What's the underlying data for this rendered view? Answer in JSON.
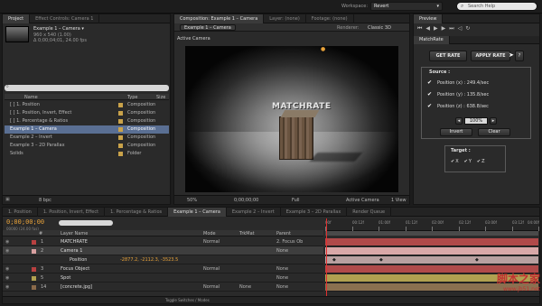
{
  "workspace": {
    "label": "Workspace:",
    "value": "Revert",
    "search_placeholder": "Search Help"
  },
  "project_panel": {
    "tabs": [
      "Project",
      "Effect Controls: Camera 1"
    ],
    "comp_name": "Example 1 – Camera ▾",
    "comp_size": "960 x 540 (1.00)",
    "comp_duration": "Δ 0;00;04;01, 24.00 fps",
    "search_placeholder": "",
    "headers": {
      "name": "Name",
      "type": "Type",
      "size": "Size"
    },
    "items": [
      {
        "name": "[ ] 1. Position",
        "type": "Composition",
        "color": "#c9a24a",
        "selected": false
      },
      {
        "name": "[ ] 1. Position, Invert, Effect",
        "type": "Composition",
        "color": "#c9a24a",
        "selected": false
      },
      {
        "name": "[ ] 1. Percentage & Ratios",
        "type": "Composition",
        "color": "#c9a24a",
        "selected": false
      },
      {
        "name": "Example 1 – Camera",
        "type": "Composition",
        "color": "#c9a24a",
        "selected": true
      },
      {
        "name": "Example 2 – Invert",
        "type": "Composition",
        "color": "#c9a24a",
        "selected": false
      },
      {
        "name": "Example 3 – 2D Parallax",
        "type": "Composition",
        "color": "#c9a24a",
        "selected": false
      },
      {
        "name": "Solids",
        "type": "Folder",
        "color": "#c9a24a",
        "selected": false
      }
    ],
    "footer_bpc": "8 bpc"
  },
  "comp_panel": {
    "tabs": [
      "Composition: Example 1 – Camera",
      "Layer: (none)",
      "Footage: (none)"
    ],
    "comp_tab": "Example 1 – Camera",
    "renderer_label": "Renderer:",
    "renderer_value": "Classic 3D",
    "view_label": "Active Camera",
    "scene_text": "MATCHRATE",
    "footer": {
      "zoom": "50%",
      "timecode": "0;00;00;00",
      "resolution": "Full",
      "camera": "Active Camera",
      "views": "1 View"
    }
  },
  "matchrate": {
    "tabs": [
      "Preview",
      "MatchRate"
    ],
    "get_rate": "GET RATE",
    "apply_rate": "APPLY RATE",
    "help": "?",
    "source_label": "Source :",
    "sources": [
      {
        "label": "Position (x) : 249.4/sec",
        "checked": true
      },
      {
        "label": "Position (y) : 135.8/sec",
        "checked": true
      },
      {
        "label": "Position (z) : 638.8/sec",
        "checked": true
      }
    ],
    "percent": "100%",
    "invert": "Invert",
    "clear": "Clear",
    "target_label": "Target :",
    "targets": [
      {
        "label": "X",
        "checked": true
      },
      {
        "label": "Y",
        "checked": true
      },
      {
        "label": "Z",
        "checked": true
      }
    ]
  },
  "timeline": {
    "tabs": [
      "1. Position",
      "1. Position, Invert, Effect",
      "1. Percentage & Ratios",
      "Example 1 – Camera",
      "Example 2 – Invert",
      "Example 3 – 2D Parallax",
      "Render Queue"
    ],
    "active_tab": 3,
    "timecode": "0;00;00;00",
    "fps": "00000 (24.00 fps)",
    "headers": {
      "num": "#",
      "layer_name": "Layer Name",
      "mode": "Mode",
      "trkmat": "TrkMat",
      "parent": "Parent"
    },
    "layers": [
      {
        "num": "1",
        "name": "MATCHRATE",
        "mode": "Normal",
        "trkmat": "",
        "parent": "2. Focus Ob",
        "color": "#b84040"
      },
      {
        "num": "2",
        "name": "Camera 1",
        "mode": "",
        "trkmat": "",
        "parent": "None",
        "color": "#d9a0a0"
      },
      {
        "num": "",
        "name": "Position",
        "mode": "",
        "trkmat": "",
        "parent": "",
        "value": "-2877.2, -2112.3, -3523.5",
        "color": ""
      },
      {
        "num": "3",
        "name": "Focus Object",
        "mode": "Normal",
        "trkmat": "",
        "parent": "None",
        "color": "#b84040"
      },
      {
        "num": "5",
        "name": "Spot",
        "mode": "",
        "trkmat": "",
        "parent": "None",
        "color": "#b0a050"
      },
      {
        "num": "14",
        "name": "[concrete.jpg]",
        "mode": "Normal",
        "trkmat": "None",
        "parent": "None",
        "color": "#8a6a4a"
      }
    ],
    "ruler": [
      "00f",
      "00:12f",
      "01:00f",
      "01:12f",
      "02:00f",
      "02:12f",
      "03:00f",
      "03:12f",
      "04:00f"
    ],
    "bar_colors": [
      "#b04a4a",
      "#d9a8a8",
      "#b8a0a0",
      "#b04a4a",
      "#b0a050",
      "#8a7050"
    ],
    "toggle": "Toggle Switches / Modes"
  },
  "watermark": {
    "line1": "脚本之家",
    "line2": "www.jb51.net"
  },
  "colors": {
    "accent_blue": "#3a5f9a",
    "selection": "#5a6f93",
    "timecode_orange": "#e8a23a"
  }
}
